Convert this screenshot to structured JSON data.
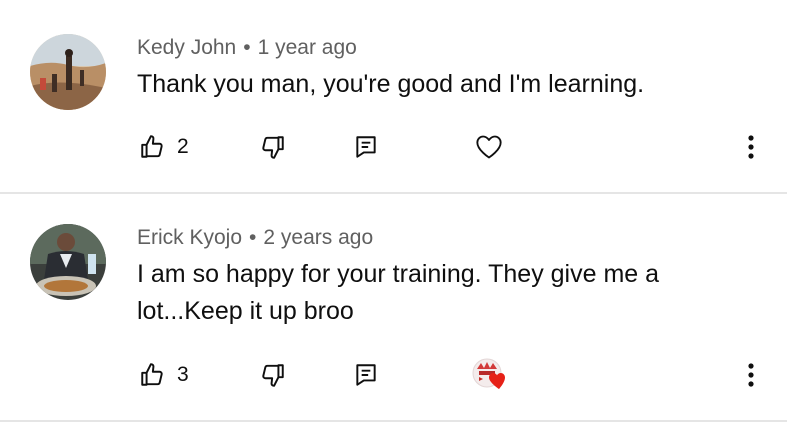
{
  "comments": [
    {
      "author": "Kedy John",
      "separator": "•",
      "time": "1 year ago",
      "text": "Thank you man, you're good and I'm learning.",
      "likes": "2",
      "avatar_icon": "user-photo-avatar",
      "heart_state": "outline"
    },
    {
      "author": "Erick Kyojo",
      "separator": "•",
      "time": "2 years ago",
      "text": "I am so happy for your training. They give me a lot...Keep it up broo",
      "likes": "3",
      "avatar_icon": "user-photo-avatar",
      "heart_state": "creator-hearted"
    }
  ],
  "icons": {
    "like": "thumbs-up-icon",
    "dislike": "thumbs-down-icon",
    "reply": "reply-icon",
    "heart": "heart-icon",
    "more": "more-vert-icon"
  },
  "colors": {
    "text": "#0f0f0f",
    "meta": "#606060",
    "divider": "#e5e5e5",
    "heart_red": "#e62117"
  }
}
